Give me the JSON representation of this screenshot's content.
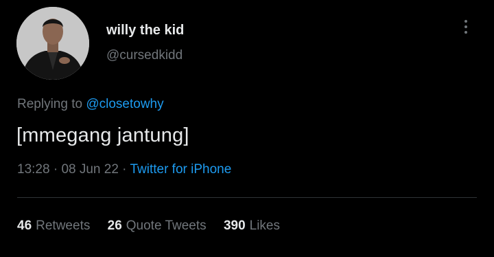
{
  "author": {
    "display_name": "willy the kid",
    "handle": "@cursedkidd",
    "avatar_icon": "profile-photo"
  },
  "reply": {
    "prefix": "Replying to ",
    "mention": "@closetowhy"
  },
  "tweet": {
    "text": "[mmegang jantung]"
  },
  "meta": {
    "time": "13:28",
    "separator": " · ",
    "date": "08 Jun 22",
    "source": "Twitter for iPhone"
  },
  "stats": {
    "retweets_count": "46",
    "retweets_label": "Retweets",
    "quotes_count": "26",
    "quotes_label": "Quote Tweets",
    "likes_count": "390",
    "likes_label": "Likes"
  },
  "icons": {
    "more": "more-vertical-icon"
  },
  "colors": {
    "background": "#000000",
    "primary_text": "#e7e9ea",
    "secondary_text": "#71767b",
    "link": "#1d9bf0",
    "divider": "#2f3336"
  }
}
